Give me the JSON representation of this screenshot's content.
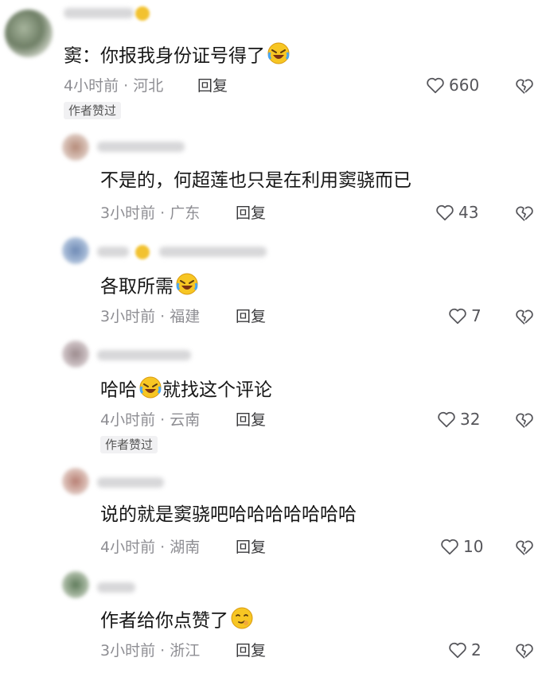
{
  "comments": [
    {
      "text": "窦：你报我身份证号得了",
      "emoji": "laugh-cry",
      "meta": "4小时前 · 河北",
      "reply": "回复",
      "likes": "660",
      "badge": "作者赞过"
    },
    {
      "text": "不是的，何超莲也只是在利用窦骁而已",
      "meta": "3小时前 · 广东",
      "reply": "回复",
      "likes": "43"
    },
    {
      "text": "各取所需",
      "emoji": "laugh-cry",
      "meta": "3小时前 · 福建",
      "reply": "回复",
      "likes": "7"
    },
    {
      "text_a": "哈哈",
      "text_b": "就找这个评论",
      "emoji": "laugh-cry",
      "meta": "4小时前 · 云南",
      "reply": "回复",
      "likes": "32",
      "badge": "作者赞过"
    },
    {
      "text": "说的就是窦骁吧哈哈哈哈哈哈哈",
      "meta": "4小时前 · 湖南",
      "reply": "回复",
      "likes": "10"
    },
    {
      "text": "作者给你点赞了",
      "emoji": "shy-smile",
      "meta": "3小时前 · 浙江",
      "reply": "回复",
      "likes": "2"
    }
  ],
  "colors": {
    "text": "#161616",
    "meta": "#8e8e93",
    "badge_bg": "#f1f1f3"
  }
}
